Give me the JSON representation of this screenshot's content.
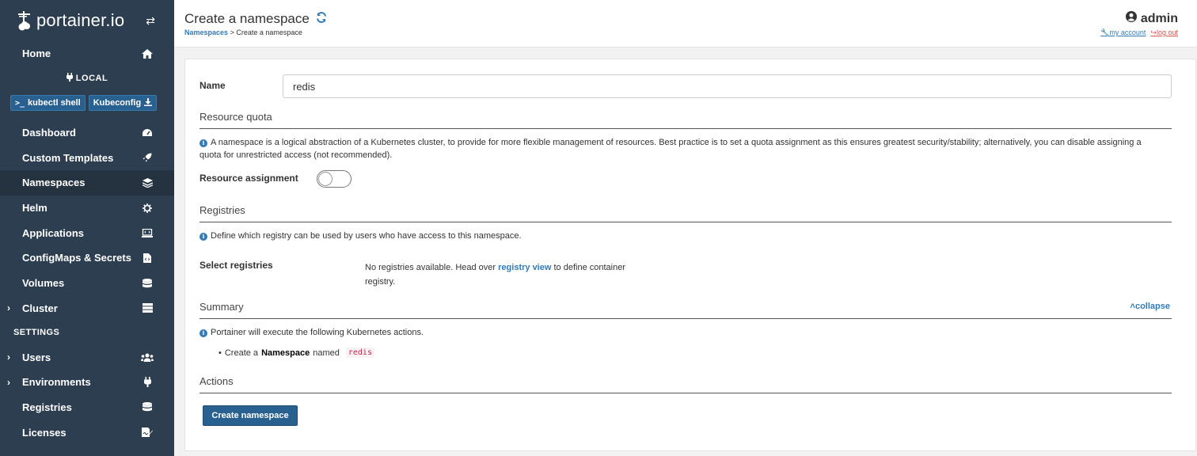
{
  "app": {
    "brand": "portainer.io"
  },
  "sidebar": {
    "home": "Home",
    "endpoint": "LOCAL",
    "kubectl_shell": "kubectl shell",
    "kubeconfig": "Kubeconfig",
    "items": [
      {
        "label": "Dashboard"
      },
      {
        "label": "Custom Templates"
      },
      {
        "label": "Namespaces"
      },
      {
        "label": "Helm"
      },
      {
        "label": "Applications"
      },
      {
        "label": "ConfigMaps & Secrets"
      },
      {
        "label": "Volumes"
      },
      {
        "label": "Cluster"
      }
    ],
    "settings_title": "SETTINGS",
    "settings_items": [
      {
        "label": "Users"
      },
      {
        "label": "Environments"
      },
      {
        "label": "Registries"
      },
      {
        "label": "Licenses"
      }
    ]
  },
  "header": {
    "title": "Create a namespace",
    "breadcrumb_link": "Namespaces",
    "breadcrumb_current": "Create a namespace",
    "user": "admin",
    "my_account": "my account",
    "log_out": "log out"
  },
  "form": {
    "name_label": "Name",
    "name_value": "redis",
    "resource_quota_title": "Resource quota",
    "resource_quota_info": "A namespace is a logical abstraction of a Kubernetes cluster, to provide for more flexible management of resources. Best practice is to set a quota assignment as this ensures greatest security/stability; alternatively, you can disable assigning a quota for unrestricted access (not recommended).",
    "resource_assignment_label": "Resource assignment",
    "registries_title": "Registries",
    "registries_info": "Define which registry can be used by users who have access to this namespace.",
    "select_registries_label": "Select registries",
    "no_registries_text_1": "No registries available. Head over",
    "registry_view_link": "registry view",
    "no_registries_text_2": "to define container",
    "no_registries_text_3": "registry.",
    "summary_title": "Summary",
    "collapse_label": "collapse",
    "summary_info": "Portainer will execute the following Kubernetes actions.",
    "summary_bullet_1": "Create a",
    "summary_bullet_bold": "Namespace",
    "summary_bullet_2": "named",
    "summary_bullet_code": "redis",
    "actions_title": "Actions",
    "create_button": "Create namespace"
  }
}
